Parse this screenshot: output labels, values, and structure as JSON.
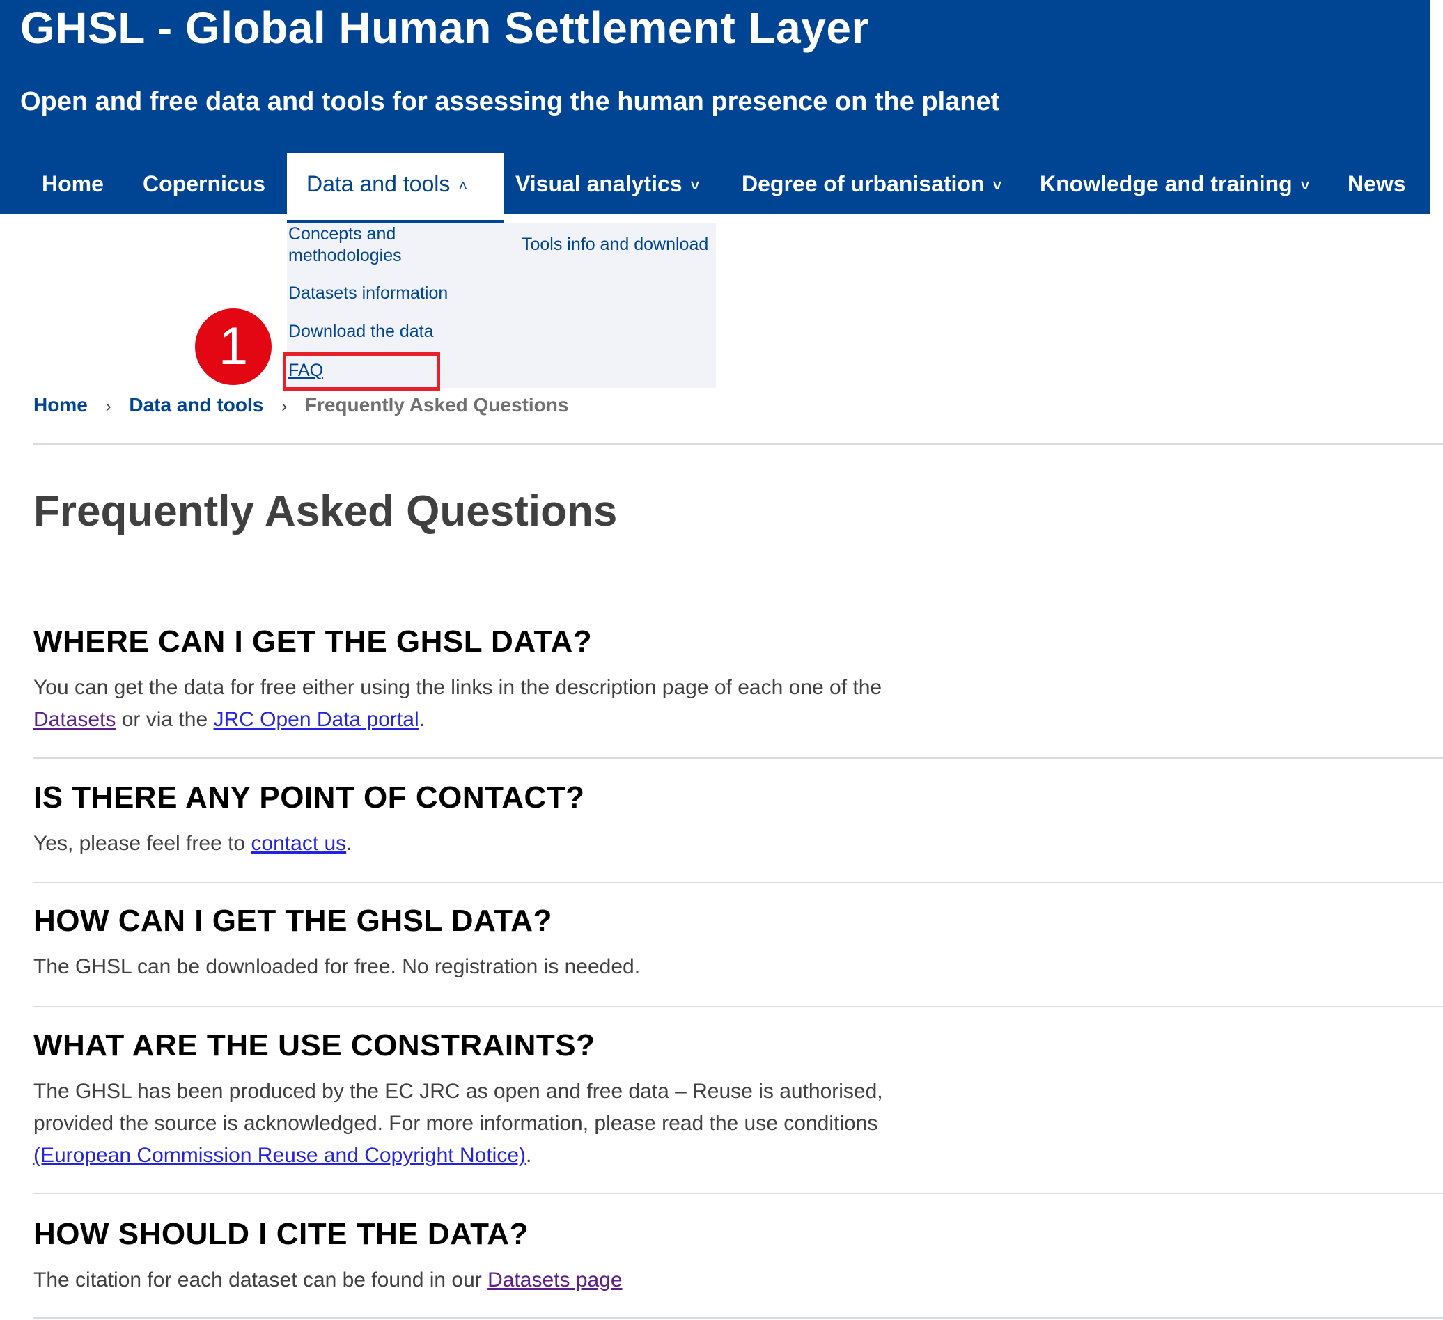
{
  "header": {
    "title": "GHSL - Global Human Settlement Layer",
    "tagline": "Open and free data and tools for assessing the human presence on the planet"
  },
  "nav": {
    "items": [
      {
        "label": "Home"
      },
      {
        "label": "Copernicus"
      },
      {
        "label": "Data and tools",
        "active": true
      },
      {
        "label": "Visual analytics"
      },
      {
        "label": "Degree of urbanisation"
      },
      {
        "label": "Knowledge and training"
      },
      {
        "label": "News"
      }
    ],
    "dropdown": {
      "items": [
        {
          "label": "Concepts and methodologies"
        },
        {
          "label": "Tools info and download"
        },
        {
          "label": "Datasets information"
        },
        {
          "label": "Download the data"
        },
        {
          "label": "FAQ"
        }
      ]
    }
  },
  "annotation": {
    "step": "1"
  },
  "breadcrumb": {
    "items": [
      "Home",
      "Data and tools",
      "Frequently Asked Questions"
    ],
    "separator": "›"
  },
  "page": {
    "title": "Frequently Asked Questions"
  },
  "faq": [
    {
      "question": "WHERE CAN I GET THE GHSL DATA?",
      "answer_part1": "You can get the data for free either using the links in the description page of each one of the",
      "link1": "Datasets",
      "answer_part2": " or via the ",
      "link2": "JRC Open Data portal",
      "answer_part3": "."
    },
    {
      "question": "IS THERE ANY POINT OF CONTACT?",
      "answer_part1": "Yes, please feel free to ",
      "link1": "contact us",
      "answer_part2": "."
    },
    {
      "question": "HOW CAN I GET THE GHSL DATA?",
      "answer_part1": "The GHSL can be downloaded for free. No registration is needed."
    },
    {
      "question": "WHAT ARE THE USE CONSTRAINTS?",
      "answer_part1": "The GHSL has been produced by the EC JRC as open and free data – Reuse is authorised, provided the source is acknowledged. For more information, please read the use conditions ",
      "link1": "(European Commission Reuse and Copyright Notice)",
      "answer_part2": "."
    },
    {
      "question": "HOW SHOULD I CITE THE DATA?",
      "answer_part1": "The citation for each dataset can be found in our ",
      "link1": "Datasets page"
    }
  ],
  "colors": {
    "brand_blue": "#004494",
    "highlight_red": "#e8202a",
    "link_blue": "#2323e0",
    "link_visited": "#5c1f8a"
  }
}
